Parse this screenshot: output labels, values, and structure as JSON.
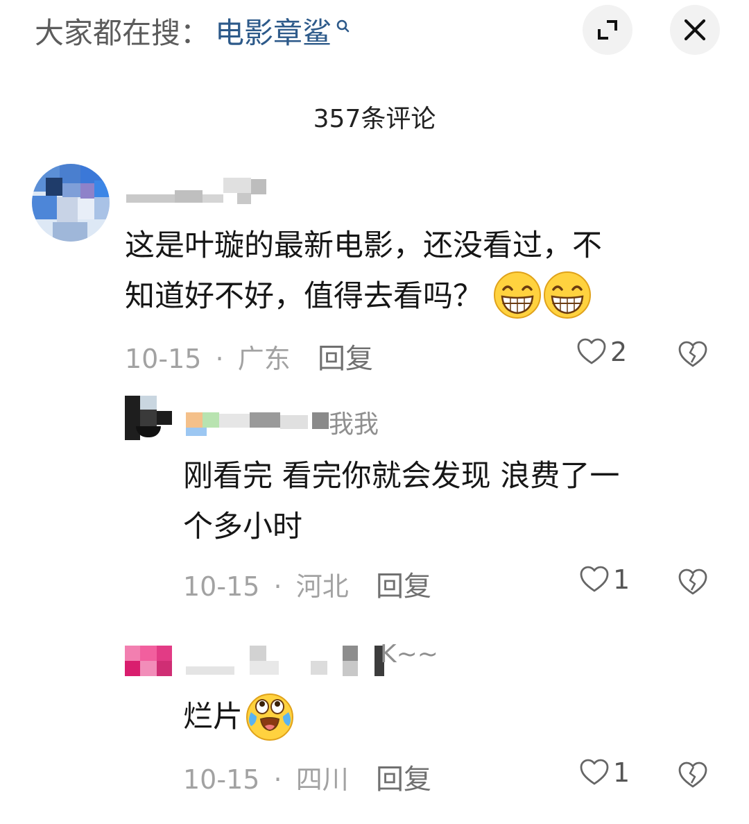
{
  "top": {
    "search_prefix": "大家都在搜：",
    "search_term": "电影章鲨",
    "search_icon": "search-icon",
    "expand_icon": "expand-icon",
    "close_icon": "close-icon"
  },
  "comment_count": "357条评论",
  "comments": [
    {
      "username_visible": "",
      "text_line1": "这是叶璇的最新电影，还没看过，不",
      "text_line2": "知道好不好，值得去看吗？",
      "emojis": [
        "grin-emoji",
        "grin-emoji"
      ],
      "date": "10-15",
      "separator": "·",
      "location": "广东",
      "reply_label": "回复",
      "likes": "2"
    },
    {
      "username_visible": "我我",
      "text_line1": "刚看完 看完你就会发现 浪费了一",
      "text_line2": "个多小时",
      "date": "10-15",
      "separator": "·",
      "location": "河北",
      "reply_label": "回复",
      "likes": "1"
    },
    {
      "username_visible": "K~~",
      "text_line1": "烂片",
      "emojis": [
        "crying-laughing-emoji"
      ],
      "date": "10-15",
      "separator": "·",
      "location": "四川",
      "reply_label": "回复",
      "likes": "1"
    }
  ],
  "colors": {
    "search_term": "#2d5a8a",
    "meta": "#a2a2a2",
    "background": "#ffffff"
  }
}
